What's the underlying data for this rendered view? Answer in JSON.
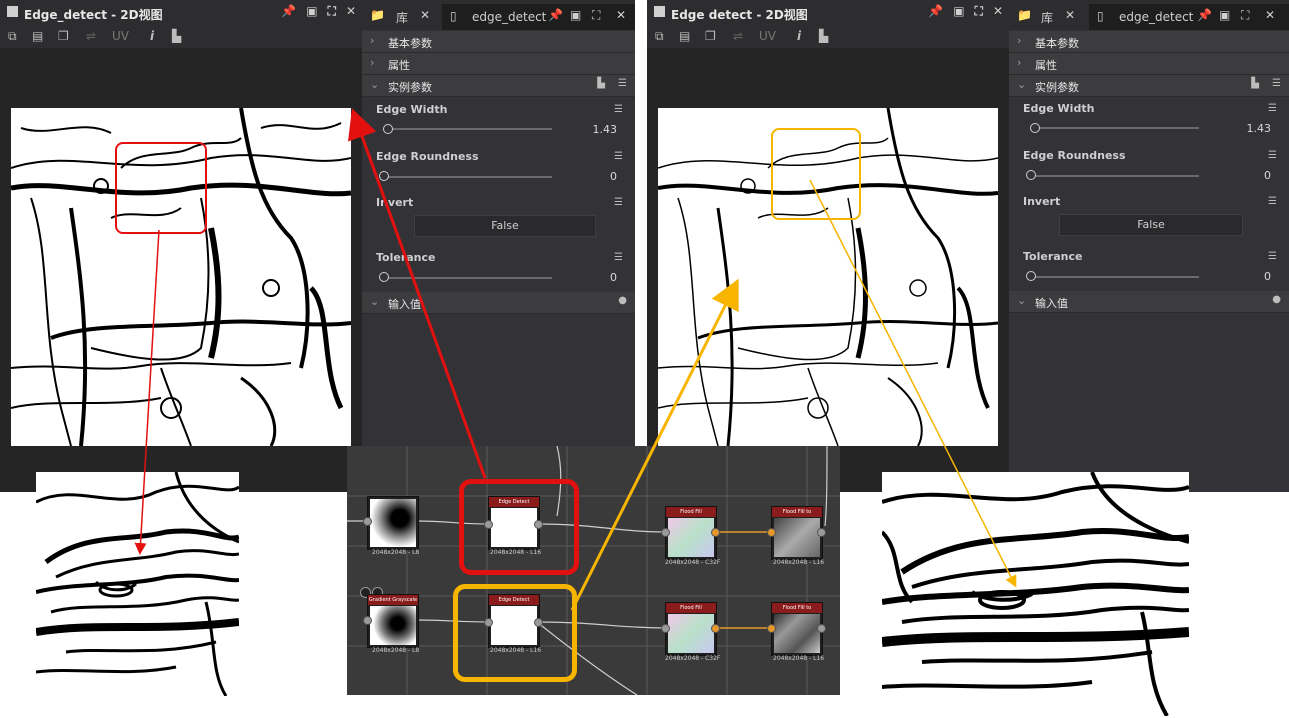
{
  "left_window": {
    "title": "Edge_detect - 2D视图",
    "toolbar_uv": "UV",
    "tab_lib": "库",
    "tab_node": "edge_detect",
    "sections": [
      "基本参数",
      "属性",
      "实例参数",
      "输入值"
    ],
    "params": {
      "edge_width": {
        "label": "Edge Width",
        "value": "1.43"
      },
      "edge_roundness": {
        "label": "Edge Roundness",
        "value": "0"
      },
      "invert": {
        "label": "Invert",
        "value": "False"
      },
      "tolerance": {
        "label": "Tolerance",
        "value": "0"
      }
    }
  },
  "right_window": {
    "title": "Edge detect - 2D视图",
    "toolbar_uv": "UV",
    "tab_lib": "库",
    "tab_node": "edge_detect",
    "sections": [
      "基本参数",
      "属性",
      "实例参数",
      "输入值"
    ],
    "params": {
      "edge_width": {
        "label": "Edge Width",
        "value": "1.43"
      },
      "edge_roundness": {
        "label": "Edge Roundness",
        "value": "0"
      },
      "invert": {
        "label": "Invert",
        "value": "False"
      },
      "tolerance": {
        "label": "Tolerance",
        "value": "0"
      }
    }
  },
  "graph": {
    "nodes": [
      {
        "title": "",
        "size": "2048x2048 - L8"
      },
      {
        "title": "Edge Detect",
        "size": "2048x2048 - L16"
      },
      {
        "title": "Flood Fill",
        "size": "2048x2048 - C32F"
      },
      {
        "title": "Flood Fill to Grayscale",
        "size": "2048x2048 - L16"
      },
      {
        "title": "Gradient Grayscale",
        "size": "2048x2048 - L8"
      },
      {
        "title": "Edge Detect",
        "size": "2048x2048 - L16"
      },
      {
        "title": "Flood Fill",
        "size": "2048x2048 - C32F"
      },
      {
        "title": "Flood Fill to Random",
        "size": "2048x2048 - L16"
      }
    ]
  },
  "colors": {
    "red_highlight": "#e31010",
    "yellow_highlight": "#f7b500"
  }
}
